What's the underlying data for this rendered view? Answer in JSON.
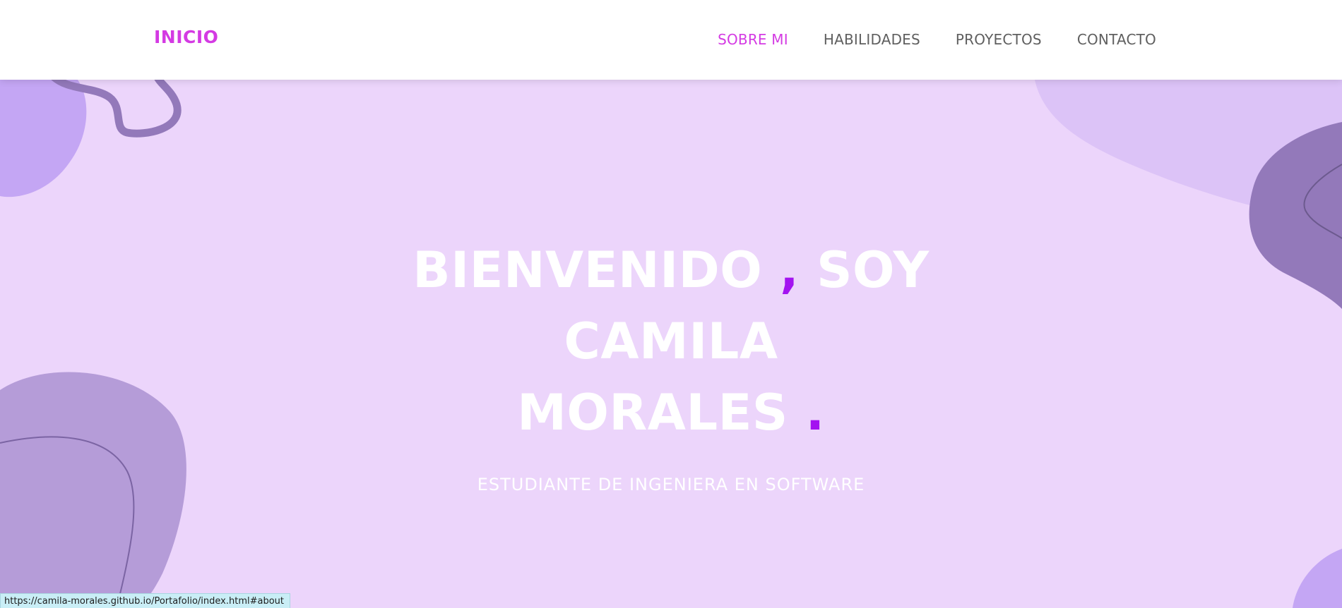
{
  "navbar": {
    "brand": "INICIO",
    "links": [
      {
        "label": "SOBRE MI",
        "active": true
      },
      {
        "label": "HABILIDADES",
        "active": false
      },
      {
        "label": "PROYECTOS",
        "active": false
      },
      {
        "label": "CONTACTO",
        "active": false
      }
    ]
  },
  "hero": {
    "line1_word": "BIENVENIDO",
    "line1_comma": ",",
    "line1_soy": "SOY",
    "name_first": "CAMILA",
    "name_last": "MORALES",
    "period": ".",
    "subtitle": "ESTUDIANTE DE INGENIERA EN SOFTWARE"
  },
  "status_bar": {
    "url": "https://camila-morales.github.io/Portafolio/index.html#about"
  },
  "colors": {
    "accent_pink": "#d43ae3",
    "accent_purple": "#a313f0",
    "hero_background": "#ecd5fb",
    "blob_light": "#dcc3f7",
    "blob_mid": "#c4a6f4",
    "blob_dark": "#9379ba",
    "nav_text": "#5f5f5f"
  }
}
